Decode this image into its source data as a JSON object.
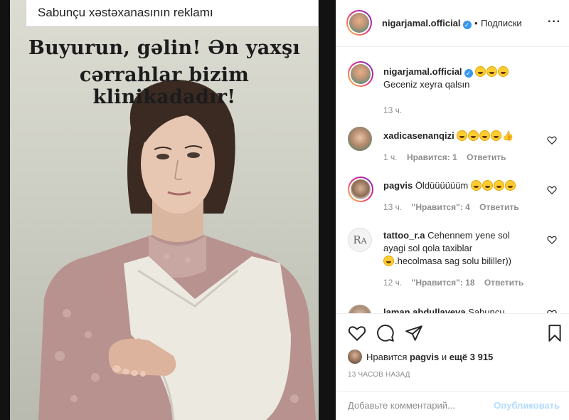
{
  "post_image": {
    "caption": "Sabunçu xəstəxanasının reklamı",
    "headline_line1": "Buyurun, gəlin! Ən yaxşı",
    "headline_line2": "cərrahlar bizim klinikadadır!"
  },
  "header": {
    "username": "nigarjamal.official",
    "separator": "•",
    "follow_status": "Подписки",
    "more_icon": "more-horizontal-icon"
  },
  "caption": {
    "username": "nigarjamal.official",
    "text": "Geceniz xeyra qalsın",
    "time": "13 ч."
  },
  "comments": [
    {
      "username": "xadicasenanqizi",
      "text": "",
      "time": "1 ч.",
      "likes": "Нравится: 1",
      "reply": "Ответить"
    },
    {
      "username": "pagvis",
      "text": "Öldüüüüüüm",
      "time": "13 ч.",
      "likes": "\"Нравится\": 4",
      "reply": "Ответить"
    },
    {
      "username": "tattoo_r.a",
      "text": "Cehennem yene sol ayagi sol qola taxiblar",
      "text_tail": ".hecolmasa sag solu bililler))",
      "time": "12 ч.",
      "likes": "\"Нравится\": 18",
      "reply": "Ответить"
    },
    {
      "username": "laman.abdullayeva",
      "text": "Sabunçu"
    }
  ],
  "actions": {
    "like_icon": "heart-icon",
    "comment_icon": "comment-icon",
    "share_icon": "share-icon",
    "save_icon": "bookmark-icon"
  },
  "likes": {
    "prefix": "Нравится",
    "user": "pagvis",
    "middle": "и",
    "others": "ещё 3 915"
  },
  "post_time": "13 ЧАСОВ НАЗАД",
  "add_comment": {
    "placeholder": "Добавьте комментарий...",
    "publish_label": "Опубликовать"
  },
  "colors": {
    "verified": "#3897f0",
    "publish_disabled": "#b3dbff",
    "muted_text": "#8e8e8e"
  }
}
